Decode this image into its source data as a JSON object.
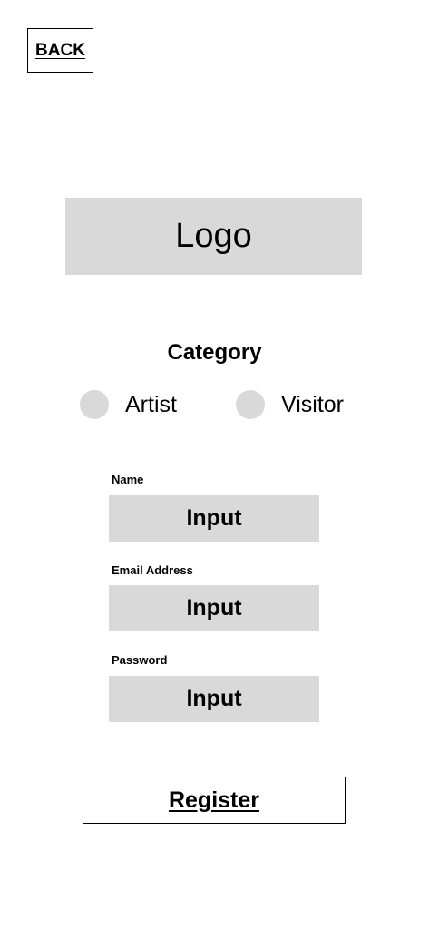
{
  "header": {
    "back_label": "BACK"
  },
  "logo": {
    "label": "Logo"
  },
  "category": {
    "title": "Category",
    "options": [
      {
        "label": "Artist"
      },
      {
        "label": "Visitor"
      }
    ]
  },
  "form": {
    "fields": [
      {
        "label": "Name",
        "value": "Input"
      },
      {
        "label": "Email Address",
        "value": "Input"
      },
      {
        "label": "Password",
        "value": "Input"
      }
    ],
    "register_label": "Register"
  },
  "colors": {
    "placeholder_gray": "#d9d9d9",
    "border": "#000000",
    "background": "#ffffff"
  }
}
